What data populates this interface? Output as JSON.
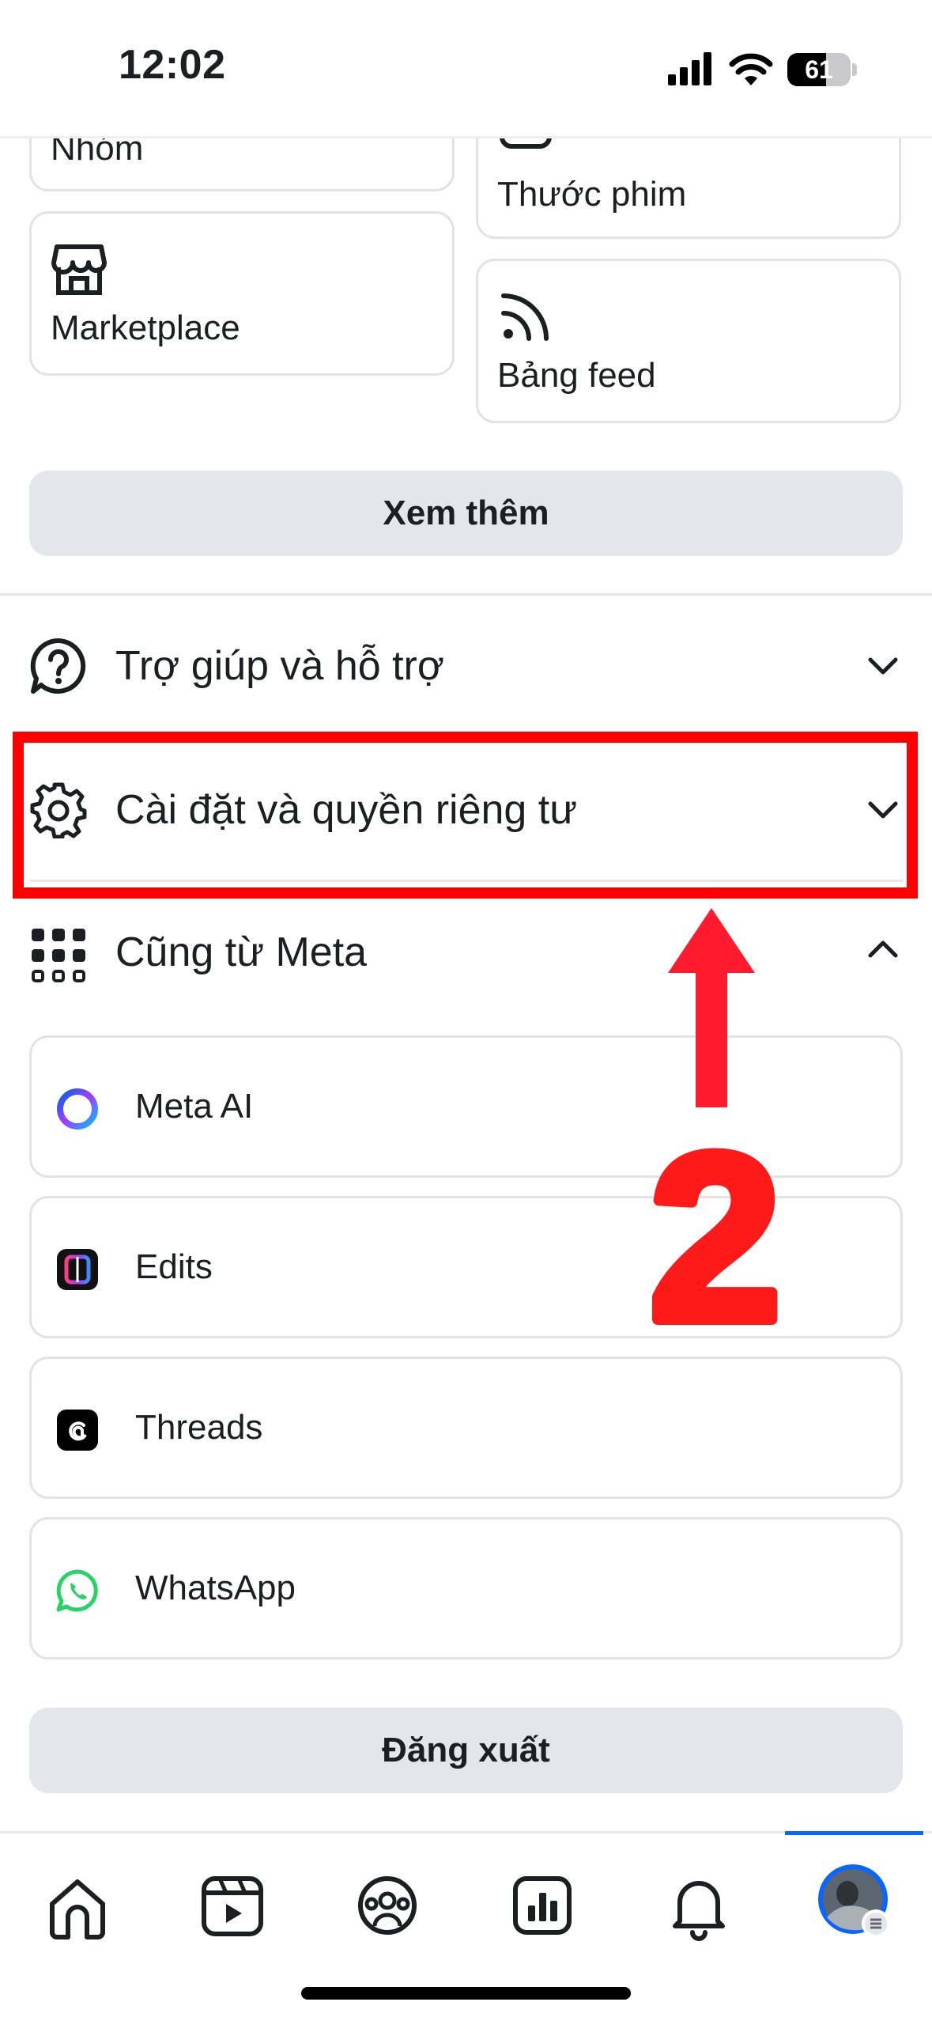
{
  "status_bar": {
    "time": "12:02",
    "battery": "61"
  },
  "shortcuts": {
    "groups_label": "Nhóm",
    "reels_label": "Thước phim",
    "marketplace_label": "Marketplace",
    "feeds_label": "Bảng feed"
  },
  "see_more_label": "Xem thêm",
  "sections": {
    "help_label": "Trợ giúp và hỗ trợ",
    "settings_label": "Cài đặt và quyền riêng tư",
    "meta_label": "Cũng từ Meta"
  },
  "meta_apps": [
    {
      "label": "Meta AI",
      "icon": "meta-ai-icon"
    },
    {
      "label": "Edits",
      "icon": "edits-icon"
    },
    {
      "label": "Threads",
      "icon": "threads-icon"
    },
    {
      "label": "WhatsApp",
      "icon": "whatsapp-icon"
    }
  ],
  "logout_label": "Đăng xuất",
  "annotation": {
    "step_number": "2",
    "highlight_color": "#ff0000"
  },
  "tabbar": {
    "active_tab": "menu",
    "tabs": [
      "home-icon",
      "video-icon",
      "groups-icon",
      "dashboard-icon",
      "bell-icon",
      "profile-avatar"
    ],
    "accent_color": "#0866ff"
  }
}
